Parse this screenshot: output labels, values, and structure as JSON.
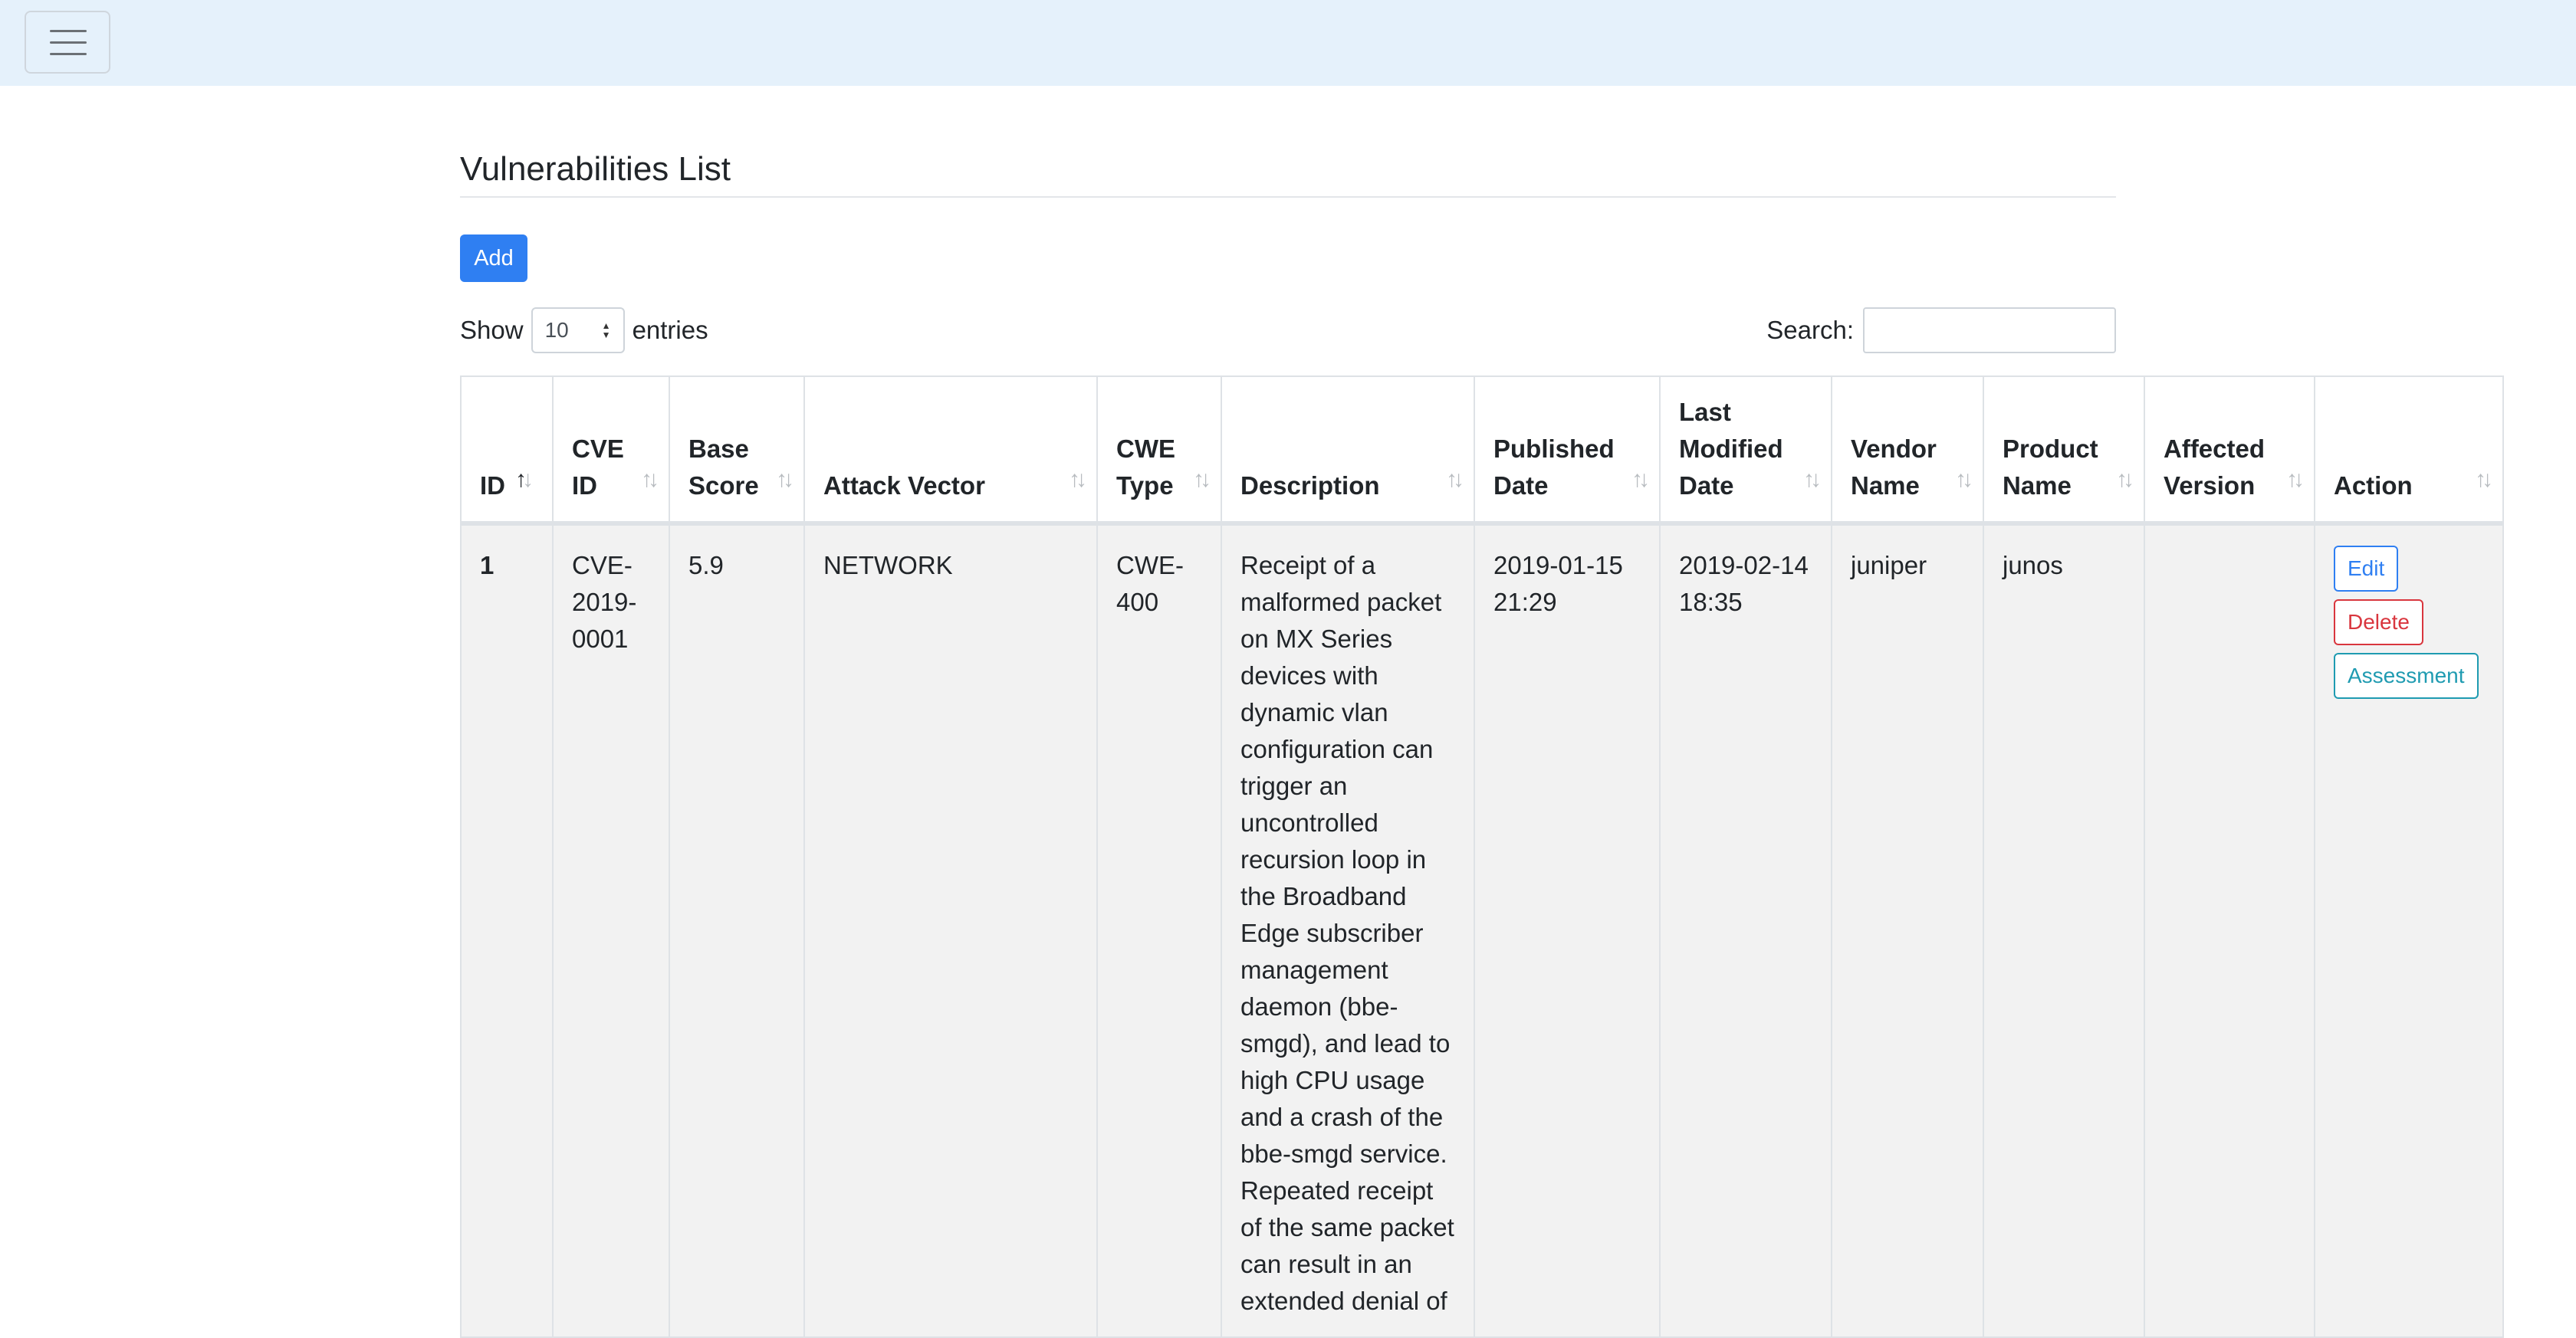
{
  "page": {
    "title": "Vulnerabilities List"
  },
  "toolbar": {
    "add_label": "Add"
  },
  "length_control": {
    "prefix": "Show",
    "value": "10",
    "suffix": "entries"
  },
  "search": {
    "label": "Search:",
    "placeholder": ""
  },
  "table": {
    "columns": [
      {
        "label": "ID",
        "sort_state": "ascending"
      },
      {
        "label": "CVE ID",
        "sort_state": "none"
      },
      {
        "label": "Base Score",
        "sort_state": "none"
      },
      {
        "label": "Attack Vector",
        "sort_state": "none"
      },
      {
        "label": "CWE Type",
        "sort_state": "none"
      },
      {
        "label": "Description",
        "sort_state": "none"
      },
      {
        "label": "Published Date",
        "sort_state": "none"
      },
      {
        "label": "Last Modified Date",
        "sort_state": "none"
      },
      {
        "label": "Vendor Name",
        "sort_state": "none"
      },
      {
        "label": "Product Name",
        "sort_state": "none"
      },
      {
        "label": "Affected Version",
        "sort_state": "none"
      },
      {
        "label": "Action",
        "sort_state": "none"
      }
    ],
    "rows": [
      {
        "id": "1",
        "cve_id": "CVE-2019-0001",
        "base_score": "5.9",
        "attack_vector": "NETWORK",
        "cwe_type": "CWE-400",
        "description": "Receipt of a malformed packet on MX Series devices with dynamic vlan configuration can trigger an uncontrolled recursion loop in the Broadband Edge subscriber management daemon (bbe-smgd), and lead to high CPU usage and a crash of the bbe-smgd service. Repeated receipt of the same packet can result in an extended denial of",
        "published_date": "2019-01-15 21:29",
        "last_modified_date": "2019-02-14 18:35",
        "vendor_name": "juniper",
        "product_name": "junos",
        "affected_version": "",
        "actions": {
          "edit": "Edit",
          "delete": "Delete",
          "assessment": "Assessment"
        }
      }
    ]
  },
  "colors": {
    "navbar_bg": "#e5f1fb",
    "primary": "#2f7ff2",
    "danger": "#d9363e",
    "info": "#1f9bb1"
  }
}
